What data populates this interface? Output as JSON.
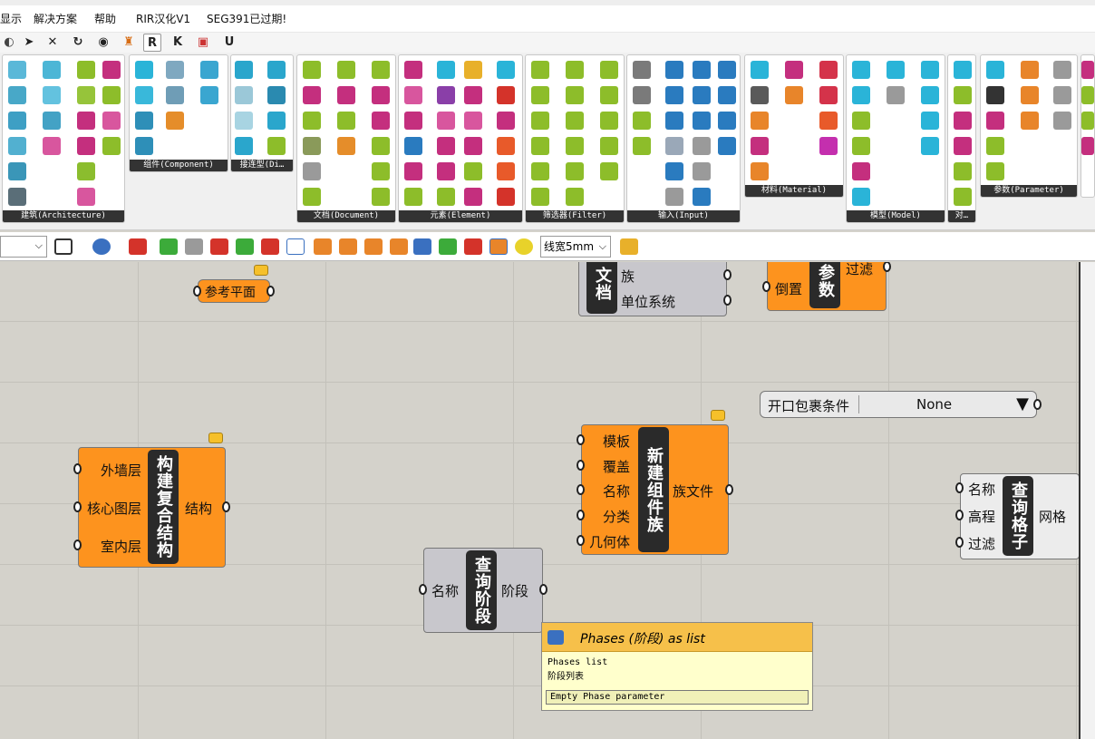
{
  "menu": [
    "显示",
    "解决方案",
    "帮助",
    "RIR汉化V1",
    "SEG391已过期!"
  ],
  "tabs": [
    "R",
    "K",
    "U"
  ],
  "ribbon_panels": [
    {
      "label": "建筑(Architecture)"
    },
    {
      "label": "组件(Component)"
    },
    {
      "label": "接连型(Di…"
    },
    {
      "label": "文档(Document)"
    },
    {
      "label": "元素(Element)"
    },
    {
      "label": "筛选器(Filter)"
    },
    {
      "label": "输入(Input)"
    },
    {
      "label": "材料(Material)"
    },
    {
      "label": "模型(Model)"
    },
    {
      "label": "对…"
    },
    {
      "label": "参数(Parameter)"
    }
  ],
  "toolbar2": {
    "line_width": "线宽5mm"
  },
  "nodes": {
    "ref_plane": {
      "label": "参考平面"
    },
    "doc_partial": {
      "core": "文档",
      "outputs": [
        "族",
        "单位系统"
      ]
    },
    "param_partial": {
      "core": "参数",
      "inputs": [
        "倒置"
      ],
      "outputs": [
        "过滤"
      ]
    },
    "open_wrap": {
      "label": "开口包裹条件",
      "value": "None"
    },
    "compound": {
      "core": "构建复合结构",
      "inputs": [
        "外墙层",
        "核心图层",
        "室内层"
      ],
      "outputs": [
        "结构"
      ]
    },
    "new_family": {
      "core": "新建组件族",
      "inputs": [
        "模板",
        "覆盖",
        "名称",
        "分类",
        "几何体"
      ],
      "outputs": [
        "族文件"
      ]
    },
    "query_phase": {
      "core": "查询阶段",
      "inputs": [
        "名称"
      ],
      "outputs": [
        "阶段"
      ]
    },
    "query_grid": {
      "core": "查询格子",
      "inputs": [
        "名称",
        "高程",
        "过滤"
      ],
      "outputs": [
        "网格"
      ]
    }
  },
  "tooltip": {
    "title": "Phases (阶段) as list",
    "line1": "Phases list",
    "line2": "阶段列表",
    "status": "Empty Phase parameter"
  }
}
